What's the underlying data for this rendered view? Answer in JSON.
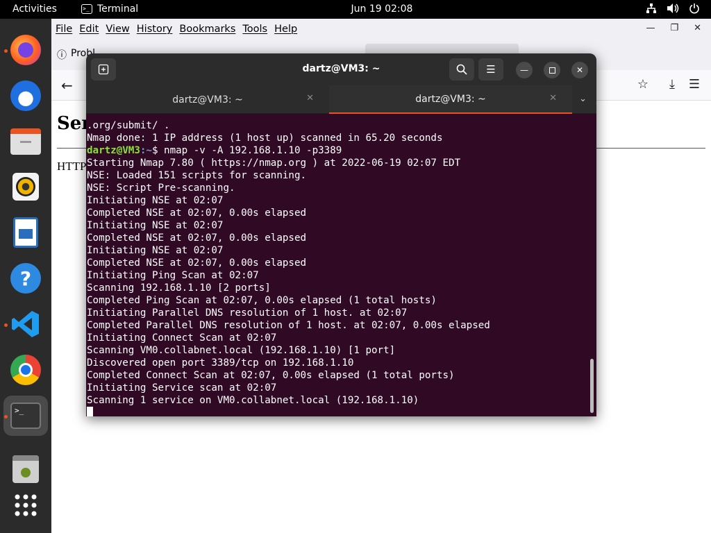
{
  "topbar": {
    "activities": "Activities",
    "app_name": "Terminal",
    "clock": "Jun 19  02:08",
    "tray_icons": [
      "network-icon",
      "volume-icon",
      "power-icon"
    ]
  },
  "dock": {
    "items": [
      {
        "name": "firefox",
        "running": true,
        "active": false
      },
      {
        "name": "thunderbird",
        "running": false,
        "active": false
      },
      {
        "name": "files",
        "running": false,
        "active": false
      },
      {
        "name": "rhythmbox",
        "running": false,
        "active": false
      },
      {
        "name": "libreoffice-writer",
        "running": false,
        "active": false
      },
      {
        "name": "help",
        "running": false,
        "active": false
      },
      {
        "name": "vscode",
        "running": true,
        "active": false
      },
      {
        "name": "chrome",
        "running": false,
        "active": false
      },
      {
        "name": "terminal",
        "running": true,
        "active": true
      },
      {
        "name": "trash",
        "running": false,
        "active": false
      },
      {
        "name": "show-apps",
        "running": false,
        "active": false
      }
    ]
  },
  "firefox": {
    "menu": [
      "File",
      "Edit",
      "View",
      "History",
      "Bookmarks",
      "Tools",
      "Help"
    ],
    "tab1_label": "Probl",
    "page_heading": "Ser",
    "page_text": "HTTP"
  },
  "terminal": {
    "title": "dartz@VM3: ~",
    "tabs": [
      {
        "label": "dartz@VM3: ~",
        "active": false
      },
      {
        "label": "dartz@VM3: ~",
        "active": true
      }
    ],
    "prompt_user": "dartz@VM3",
    "prompt_path": ":~",
    "prompt_symbol": "$",
    "command": " nmap -v -A 192.168.1.10 -p3389",
    "lines_before": [
      ".org/submit/ .",
      "Nmap done: 1 IP address (1 host up) scanned in 65.20 seconds"
    ],
    "lines_after": [
      "Starting Nmap 7.80 ( https://nmap.org ) at 2022-06-19 02:07 EDT",
      "NSE: Loaded 151 scripts for scanning.",
      "NSE: Script Pre-scanning.",
      "Initiating NSE at 02:07",
      "Completed NSE at 02:07, 0.00s elapsed",
      "Initiating NSE at 02:07",
      "Completed NSE at 02:07, 0.00s elapsed",
      "Initiating NSE at 02:07",
      "Completed NSE at 02:07, 0.00s elapsed",
      "Initiating Ping Scan at 02:07",
      "Scanning 192.168.1.10 [2 ports]",
      "Completed Ping Scan at 02:07, 0.00s elapsed (1 total hosts)",
      "Initiating Parallel DNS resolution of 1 host. at 02:07",
      "Completed Parallel DNS resolution of 1 host. at 02:07, 0.00s elapsed",
      "Initiating Connect Scan at 02:07",
      "Scanning VM0.collabnet.local (192.168.1.10) [1 port]",
      "Discovered open port 3389/tcp on 192.168.1.10",
      "Completed Connect Scan at 02:07, 0.00s elapsed (1 total ports)",
      "Initiating Service scan at 02:07",
      "Scanning 1 service on VM0.collabnet.local (192.168.1.10)"
    ]
  },
  "colors": {
    "terminal_bg": "#300a24",
    "accent": "#e95420",
    "prompt_user": "#8ae234",
    "prompt_path": "#729fcf"
  }
}
